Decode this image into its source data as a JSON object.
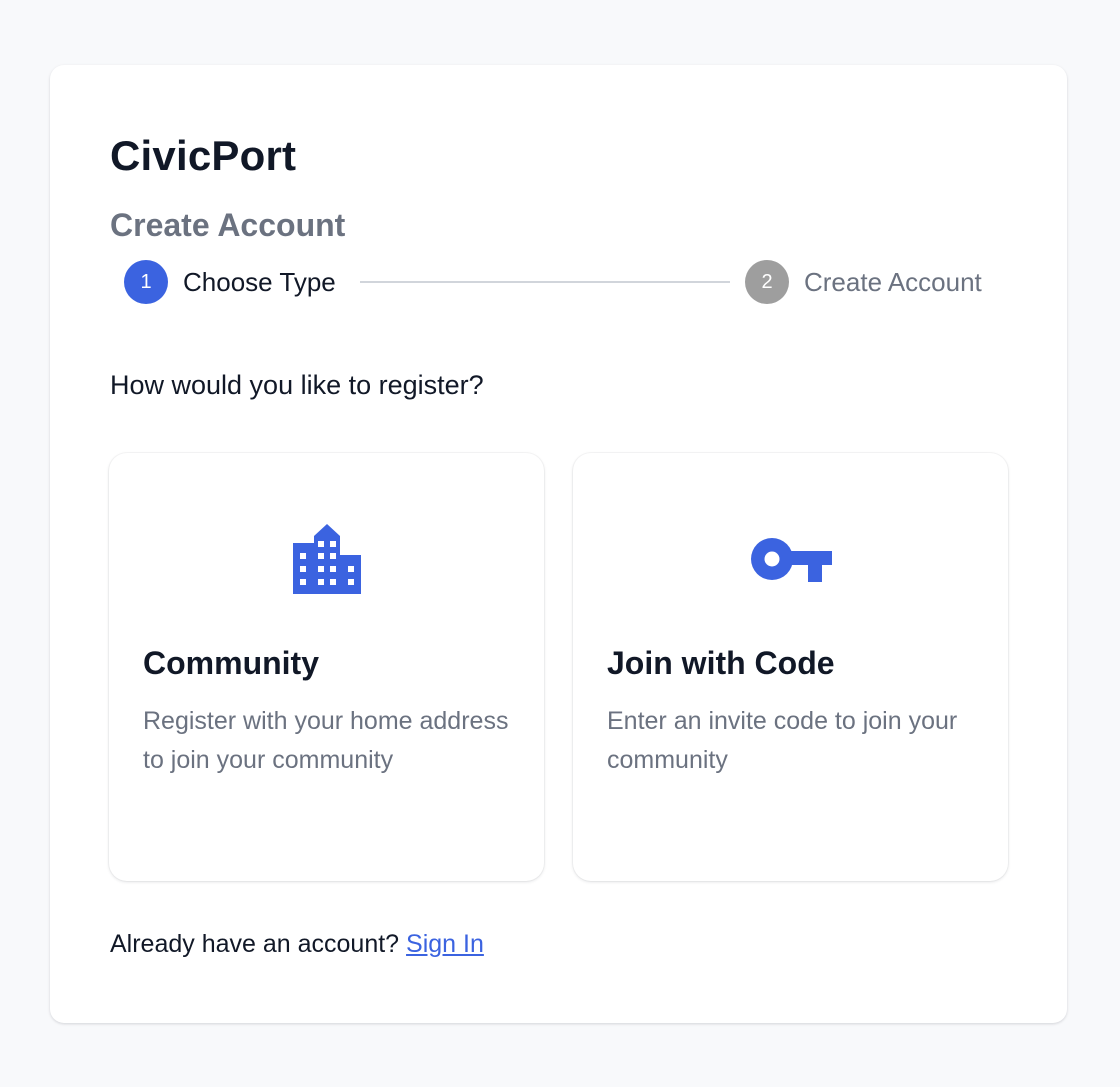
{
  "brand": {
    "name": "CivicPort"
  },
  "page": {
    "subtitle": "Create Account"
  },
  "stepper": {
    "steps": [
      {
        "number": "1",
        "label": "Choose Type",
        "state": "active"
      },
      {
        "number": "2",
        "label": "Create Account",
        "state": "inactive"
      }
    ]
  },
  "question": "How would you like to register?",
  "options": [
    {
      "icon": "building-icon",
      "title": "Community",
      "description": "Register with your home address to join your community"
    },
    {
      "icon": "key-icon",
      "title": "Join with Code",
      "description": "Enter an invite code to join your community"
    }
  ],
  "footer": {
    "prompt": "Already have an account?",
    "link_label": "Sign In"
  },
  "colors": {
    "accent": "#3b63e0",
    "inactive_step": "#9e9e9e",
    "background": "#f8f9fb",
    "text_primary": "#111827",
    "text_muted": "#6b7280"
  }
}
